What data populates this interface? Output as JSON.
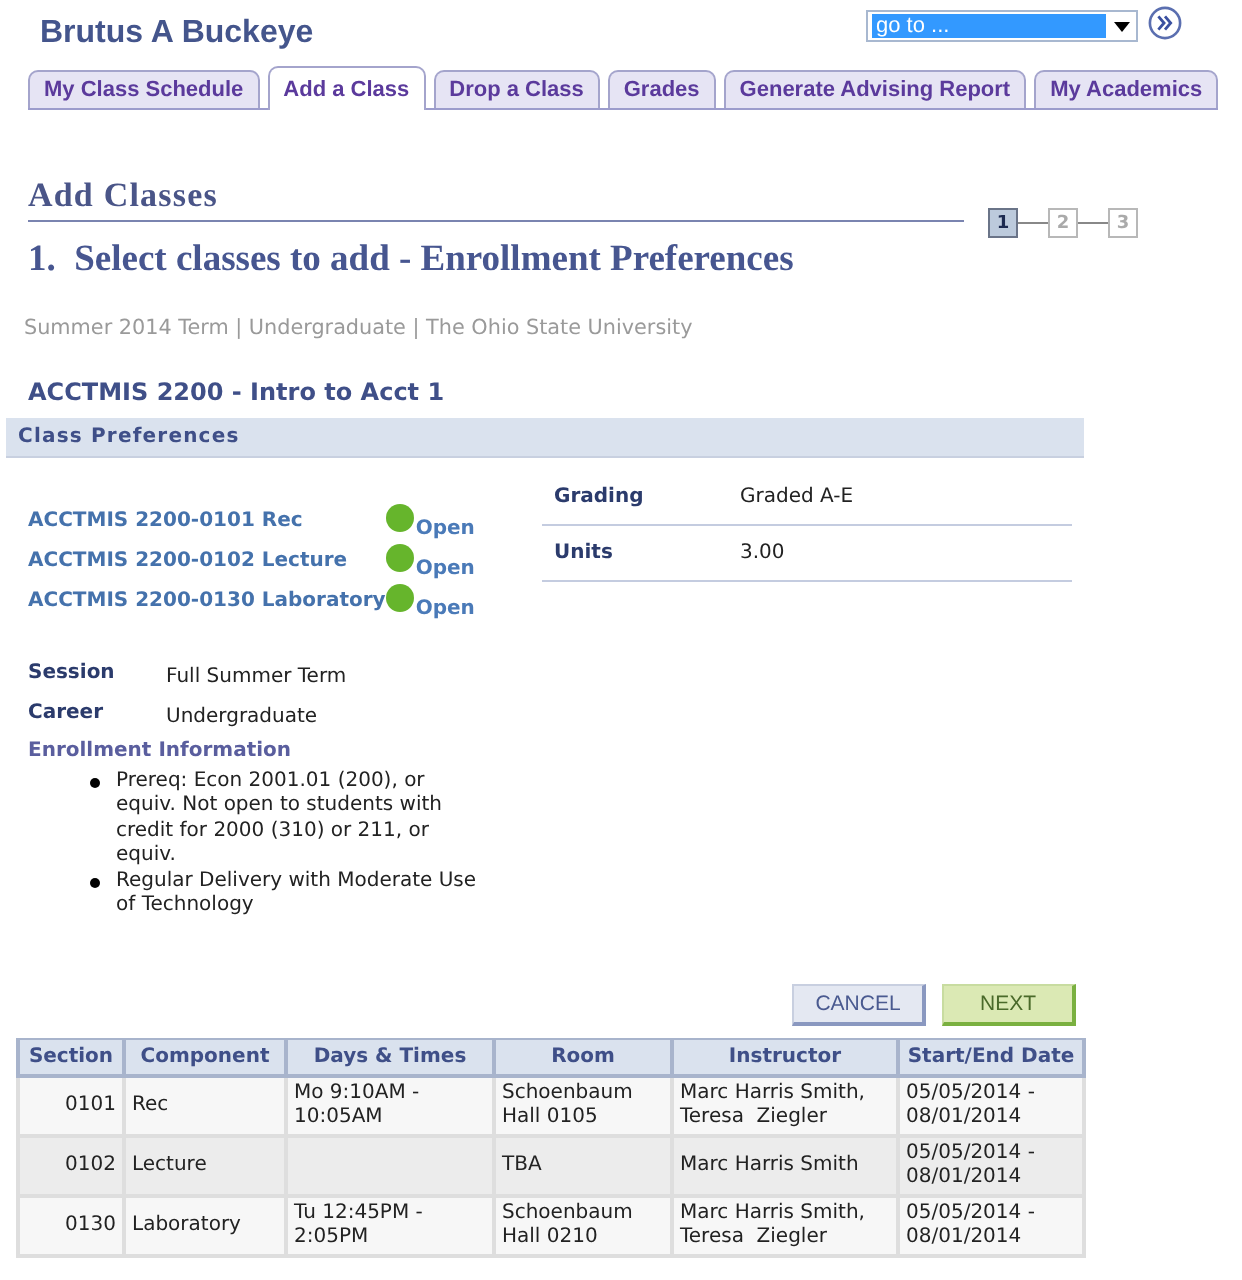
{
  "header": {
    "name": "Brutus A Buckeye",
    "goto": {
      "value": "go to ..."
    }
  },
  "tabs": [
    {
      "label": "My Class Schedule",
      "selected": false
    },
    {
      "label": "Add a Class",
      "selected": true
    },
    {
      "label": "Drop a Class",
      "selected": false
    },
    {
      "label": "Grades",
      "selected": false
    },
    {
      "label": "Generate Advising Report",
      "selected": false
    },
    {
      "label": "My Academics",
      "selected": false
    }
  ],
  "page": {
    "title": "Add Classes",
    "steps": [
      {
        "label": "1",
        "selected": true
      },
      {
        "label": "2",
        "selected": false
      },
      {
        "label": "3",
        "selected": false
      }
    ],
    "heading": "1.  Select classes to add - Enrollment Preferences",
    "term": "Summer 2014 Term | Undergraduate | The Ohio State University",
    "course": "ACCTMIS 2200 - Intro to Acct 1"
  },
  "preferences": {
    "title": "Class Preferences",
    "sections": [
      {
        "label": "ACCTMIS 2200-0101 Rec",
        "status": {
          "kind": "open",
          "label": "Open"
        }
      },
      {
        "label": "ACCTMIS 2200-0102 Lecture",
        "status": {
          "kind": "open",
          "label": "Open"
        }
      },
      {
        "label": "ACCTMIS 2200-0130 Laboratory",
        "status": {
          "kind": "open",
          "label": "Open"
        }
      }
    ],
    "details": [
      {
        "label": "Grading",
        "value": "Graded A-E"
      },
      {
        "label": "Units",
        "value": "3.00"
      }
    ],
    "info": [
      {
        "label": "Session",
        "value": "Full Summer Term"
      },
      {
        "label": "Career",
        "value": "Undergraduate"
      }
    ],
    "enrollment_info": {
      "title": "Enrollment Information",
      "items": [
        "Prereq: Econ 2001.01 (200), or equiv. Not open to students with credit for 2000 (310) or 211, or equiv.",
        "Regular Delivery with Moderate Use of Technology"
      ]
    }
  },
  "buttons": [
    {
      "label": "CANCEL",
      "kind": "cancel"
    },
    {
      "label": "NEXT",
      "kind": "next"
    }
  ],
  "table": {
    "columns": [
      "Section",
      "Component",
      "Days & Times",
      "Room",
      "Instructor",
      "Start/End Date"
    ],
    "rows": [
      {
        "section": "0101",
        "component": "Rec",
        "days_times": "Mo 9:10AM - 10:05AM",
        "room": "Schoenbaum Hall 0105",
        "instructor": "Marc Harris Smith, Teresa  Ziegler",
        "dates": "05/05/2014 - 08/01/2014"
      },
      {
        "section": "0102",
        "component": "Lecture",
        "room": "TBA",
        "instructor": "Marc Harris Smith",
        "dates": "05/05/2014 - 08/01/2014"
      },
      {
        "section": "0130",
        "component": "Laboratory",
        "days_times": "Tu 12:45PM - 2:05PM",
        "room": "Schoenbaum Hall 0210",
        "instructor": "Marc Harris Smith, Teresa  Ziegler",
        "dates": "05/05/2014 - 08/01/2014"
      }
    ]
  }
}
